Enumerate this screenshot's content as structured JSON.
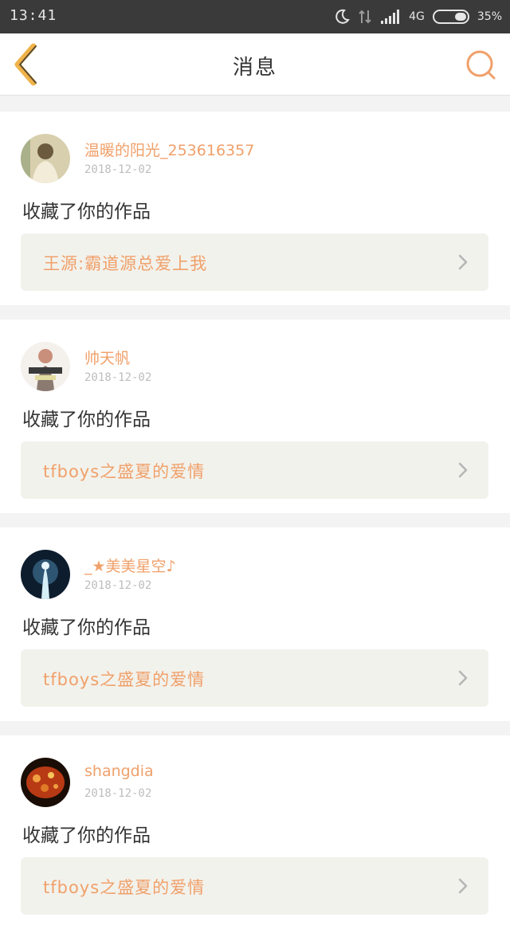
{
  "status_bar": {
    "time": "13:41",
    "network": "4G",
    "battery": "35%"
  },
  "nav": {
    "title": "消息",
    "back_icon": "chevron-left-icon",
    "search_icon": "search-icon"
  },
  "colors": {
    "accent": "#f0a06a",
    "card_bg": "#ffffff",
    "page_bg": "#f3f3f3",
    "link_bg": "#f2f2ec"
  },
  "messages": [
    {
      "username": "温暖的阳光_253616357",
      "date": "2018-12-02",
      "action": "收藏了你的作品",
      "work_title": "王源:霸道源总爱上我"
    },
    {
      "username": "帅天帆",
      "date": "2018-12-02",
      "action": "收藏了你的作品",
      "work_title": "tfboys之盛夏的爱情"
    },
    {
      "username": "_★美美星空♪",
      "date": "2018-12-02",
      "action": "收藏了你的作品",
      "work_title": "tfboys之盛夏的爱情"
    },
    {
      "username": "shangdia",
      "date": "2018-12-02",
      "action": "收藏了你的作品",
      "work_title": "tfboys之盛夏的爱情"
    }
  ]
}
